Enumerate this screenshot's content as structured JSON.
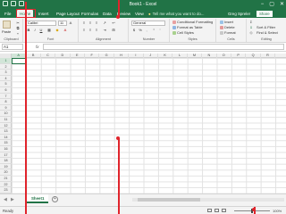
{
  "title_bar": {
    "title": "Book1 - Excel",
    "window_buttons": [
      "−",
      "▢",
      "✕"
    ]
  },
  "tabs": [
    {
      "label": "File",
      "active": false
    },
    {
      "label": "Home",
      "active": true
    },
    {
      "label": "Insert",
      "active": false
    },
    {
      "label": "Page Layout",
      "active": false
    },
    {
      "label": "Formulas",
      "active": false
    },
    {
      "label": "Data",
      "active": false
    },
    {
      "label": "Review",
      "active": false
    },
    {
      "label": "View",
      "active": false
    }
  ],
  "tell_me": "Tell me what you want to do...",
  "account": {
    "sign_in": "Greg Spreler",
    "share": "Share"
  },
  "ribbon": {
    "clipboard": {
      "label": "Clipboard",
      "paste": "Paste"
    },
    "font": {
      "label": "Font",
      "font_name": "Calibri",
      "font_size": "11",
      "bold": "B",
      "italic": "I",
      "underline": "U"
    },
    "alignment": {
      "label": "Alignment"
    },
    "number": {
      "label": "Number",
      "format": "General",
      "currency": "$",
      "percent": "%"
    },
    "styles": {
      "label": "Styles",
      "conditional": "Conditional Formatting",
      "format_table": "Format as Table",
      "cell_styles": "Cell Styles"
    },
    "cells": {
      "label": "Cells",
      "insert": "Insert",
      "delete": "Delete",
      "format": "Format"
    },
    "editing": {
      "label": "Editing",
      "sort": "Sort & Filter",
      "find": "Find & Select"
    }
  },
  "formula_bar": {
    "name_box": "A1",
    "fx": "fx",
    "value": ""
  },
  "grid": {
    "columns": [
      "A",
      "B",
      "C",
      "D",
      "E",
      "F",
      "G",
      "H",
      "I",
      "J",
      "K",
      "L",
      "M",
      "N",
      "O",
      "P",
      "Q",
      "R"
    ],
    "rows": [
      "1",
      "2",
      "3",
      "4",
      "5",
      "6",
      "7",
      "8",
      "9",
      "10",
      "11",
      "12",
      "13",
      "14",
      "15",
      "16",
      "17",
      "18",
      "19",
      "20",
      "21",
      "22",
      "23"
    ],
    "selected_cell": "A1"
  },
  "sheet_tabs": [
    "Sheet1"
  ],
  "add_sheet": "+",
  "status": {
    "text": "Ready",
    "zoom": "100%"
  },
  "colors": {
    "accent": "#217346",
    "annotation": "#e0242c"
  }
}
